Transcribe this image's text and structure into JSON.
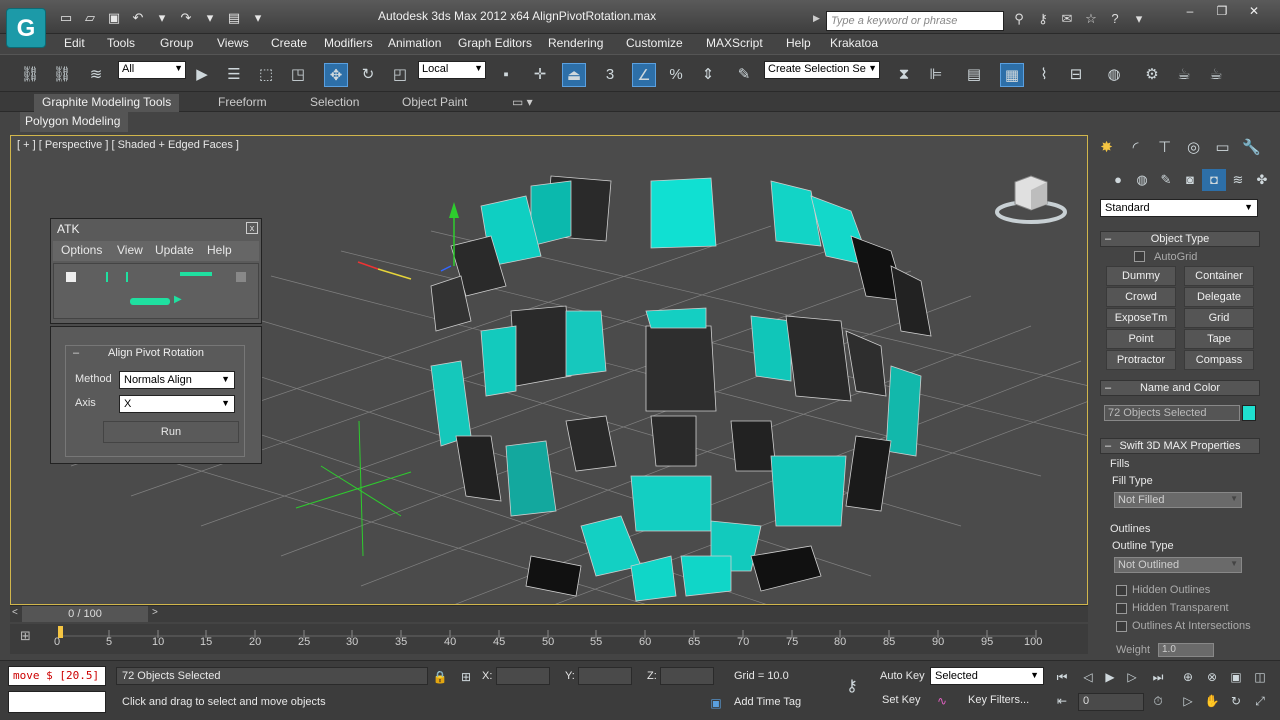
{
  "app": {
    "logo": "G",
    "window_title": "Autodesk 3ds Max  2012 x64      AlignPivotRotation.max",
    "search_placeholder": "Type a keyword or phrase"
  },
  "menu": [
    "Edit",
    "Tools",
    "Group",
    "Views",
    "Create",
    "Modifiers",
    "Animation",
    "Graph Editors",
    "Rendering",
    "Customize",
    "MAXScript",
    "Help",
    "Krakatoa"
  ],
  "toolbar": {
    "filter_value": "All",
    "coord_value": "Local",
    "selection_set_placeholder": "Create Selection Se"
  },
  "ribbon": {
    "tabs": [
      "Graphite Modeling Tools",
      "Freeform",
      "Selection",
      "Object Paint"
    ],
    "sub_tab": "Polygon Modeling"
  },
  "viewport": {
    "label": "[ + ] [ Perspective ] [ Shaded + Edged Faces ]"
  },
  "atk": {
    "title": "ATK",
    "close": "x",
    "menus": [
      "Options",
      "View",
      "Update",
      "Help"
    ]
  },
  "align_pivot": {
    "title": "Align Pivot Rotation",
    "method_label": "Method",
    "method_value": "Normals Align",
    "axis_label": "Axis",
    "axis_value": "X",
    "run_label": "Run"
  },
  "command_panel": {
    "category": "Standard",
    "object_type_title": "Object Type",
    "autogrid": "AutoGrid",
    "object_buttons": [
      "Dummy",
      "Container",
      "Crowd",
      "Delegate",
      "ExposeTm",
      "Grid",
      "Point",
      "Tape",
      "Protractor",
      "Compass"
    ],
    "name_color_title": "Name and Color",
    "name_value": "72 Objects Selected",
    "swatch_color": "#1fe0d0",
    "swift_title": "Swift 3D MAX Properties",
    "fills_label": "Fills",
    "fill_type_label": "Fill Type",
    "fill_type_value": "Not Filled",
    "outlines_label": "Outlines",
    "outline_type_label": "Outline Type",
    "outline_type_value": "Not Outlined",
    "checks": [
      "Hidden Outlines",
      "Hidden Transparent",
      "Outlines At Intersections"
    ],
    "weight_label": "Weight",
    "weight_value": "1.0"
  },
  "timeline": {
    "slider_text": "0 / 100",
    "ticks": [
      "0",
      "5",
      "10",
      "15",
      "20",
      "25",
      "30",
      "35",
      "40",
      "45",
      "50",
      "55",
      "60",
      "65",
      "70",
      "75",
      "80",
      "85",
      "90",
      "95",
      "100"
    ]
  },
  "status": {
    "listener_text": "move $ [20.5]",
    "selection_text": "72 Objects Selected",
    "prompt_text": "Click and drag to select and move objects",
    "x_label": "X:",
    "y_label": "Y:",
    "z_label": "Z:",
    "grid_text": "Grid = 10.0",
    "add_time_tag": "Add Time Tag",
    "auto_key": "Auto Key",
    "auto_key_value": "Selected",
    "set_key": "Set Key",
    "key_filters": "Key Filters...",
    "frame_value": "0"
  },
  "colors": {
    "accent_teal": "#1fe0d0",
    "viewport_border": "#d1b64c",
    "active_blue": "#2d6fa8"
  }
}
